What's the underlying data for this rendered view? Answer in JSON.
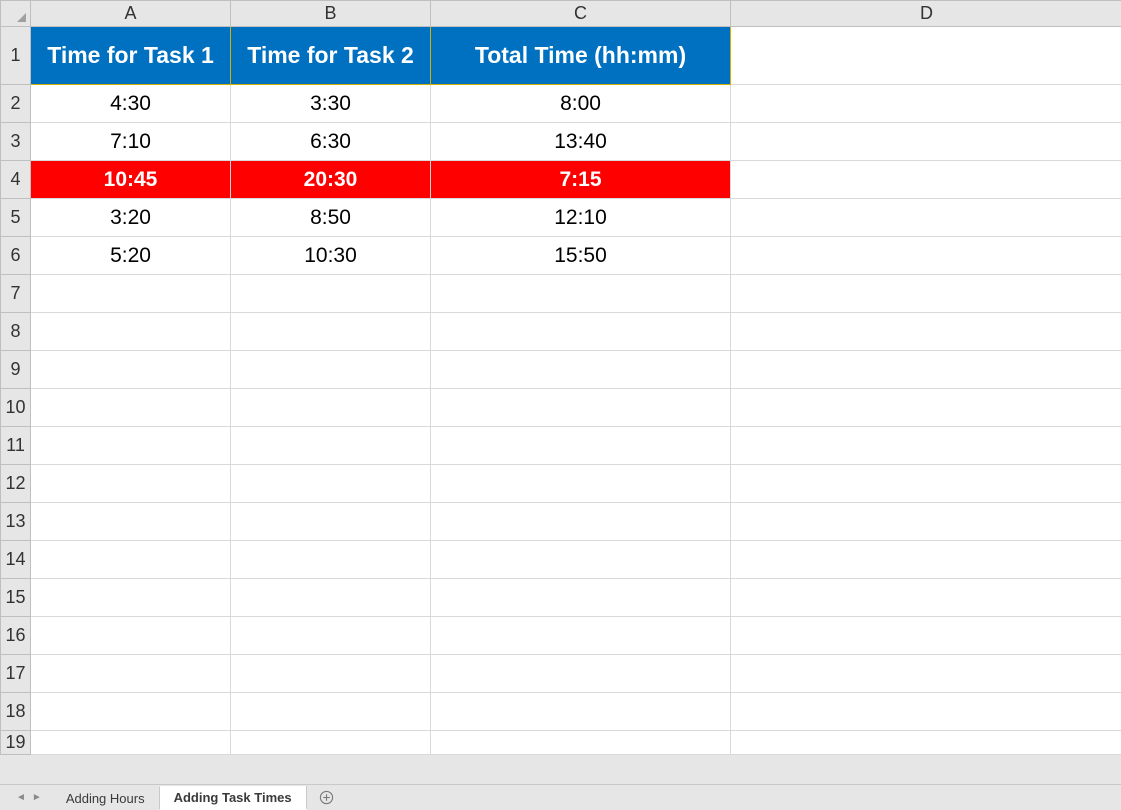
{
  "columns": [
    "A",
    "B",
    "C",
    "D"
  ],
  "rowNumbers": [
    "1",
    "2",
    "3",
    "4",
    "5",
    "6",
    "7",
    "8",
    "9",
    "10",
    "11",
    "12",
    "13",
    "14",
    "15",
    "16",
    "17",
    "18",
    "19"
  ],
  "headerRow": {
    "A": "Time for Task 1",
    "B": "Time for Task 2",
    "C": "Total Time (hh:mm)",
    "D": ""
  },
  "dataRows": [
    {
      "A": "4:30",
      "B": "3:30",
      "C": "8:00",
      "D": "",
      "highlight": false
    },
    {
      "A": "7:10",
      "B": "6:30",
      "C": "13:40",
      "D": "",
      "highlight": false
    },
    {
      "A": "10:45",
      "B": "20:30",
      "C": "7:15",
      "D": "",
      "highlight": true
    },
    {
      "A": "3:20",
      "B": "8:50",
      "C": "12:10",
      "D": "",
      "highlight": false
    },
    {
      "A": "5:20",
      "B": "10:30",
      "C": "15:50",
      "D": "",
      "highlight": false
    }
  ],
  "tabs": [
    {
      "label": "Adding Hours",
      "active": false
    },
    {
      "label": "Adding Task Times",
      "active": true
    }
  ],
  "colors": {
    "headerBg": "#0070c0",
    "highlightBg": "#ff0000"
  }
}
